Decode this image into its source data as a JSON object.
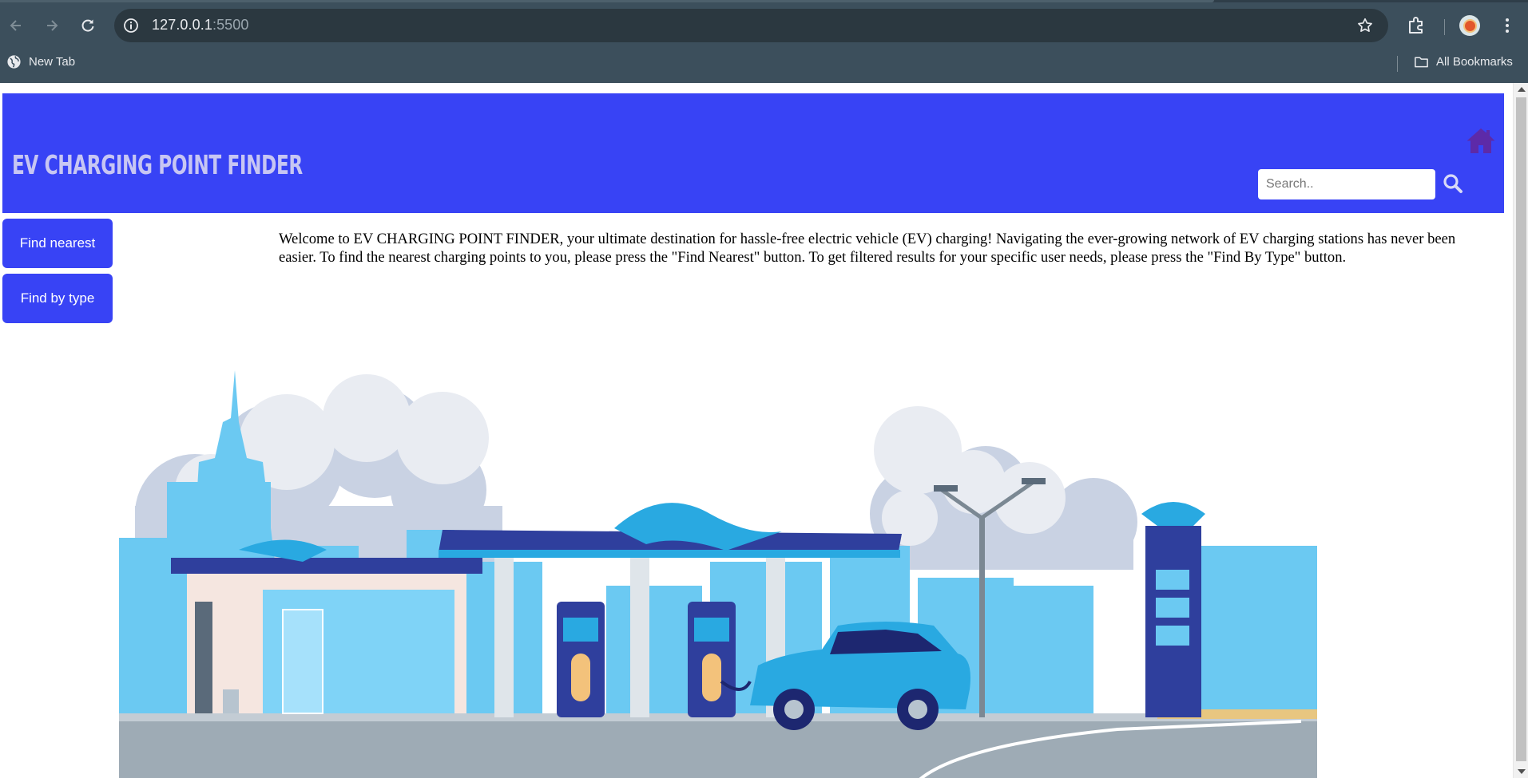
{
  "browser": {
    "address": {
      "host": "127.0.0.1",
      "port": ":5500"
    },
    "bookmarks": [
      {
        "label": "New Tab",
        "icon": "globe-icon"
      }
    ],
    "all_bookmarks_label": "All Bookmarks"
  },
  "header": {
    "title": "EV CHARGING POINT FINDER",
    "home_icon": "home-icon",
    "search": {
      "placeholder": "Search..",
      "value": ""
    }
  },
  "sidebar": {
    "buttons": [
      {
        "label": "Find nearest"
      },
      {
        "label": "Find by type"
      }
    ]
  },
  "main": {
    "welcome_text": "Welcome to EV CHARGING POINT FINDER, your ultimate destination for hassle-free electric vehicle (EV) charging! Navigating the ever-growing network of EV charging stations has never been easier. To find the nearest charging points to you, please press the \"Find Nearest\" button. To get filtered results for your specific user needs, please press the \"Find By Type\" button."
  },
  "colors": {
    "brand_blue": "#3843f5",
    "title_text": "#c7c6f3",
    "home_icon": "#5d2aa8"
  }
}
